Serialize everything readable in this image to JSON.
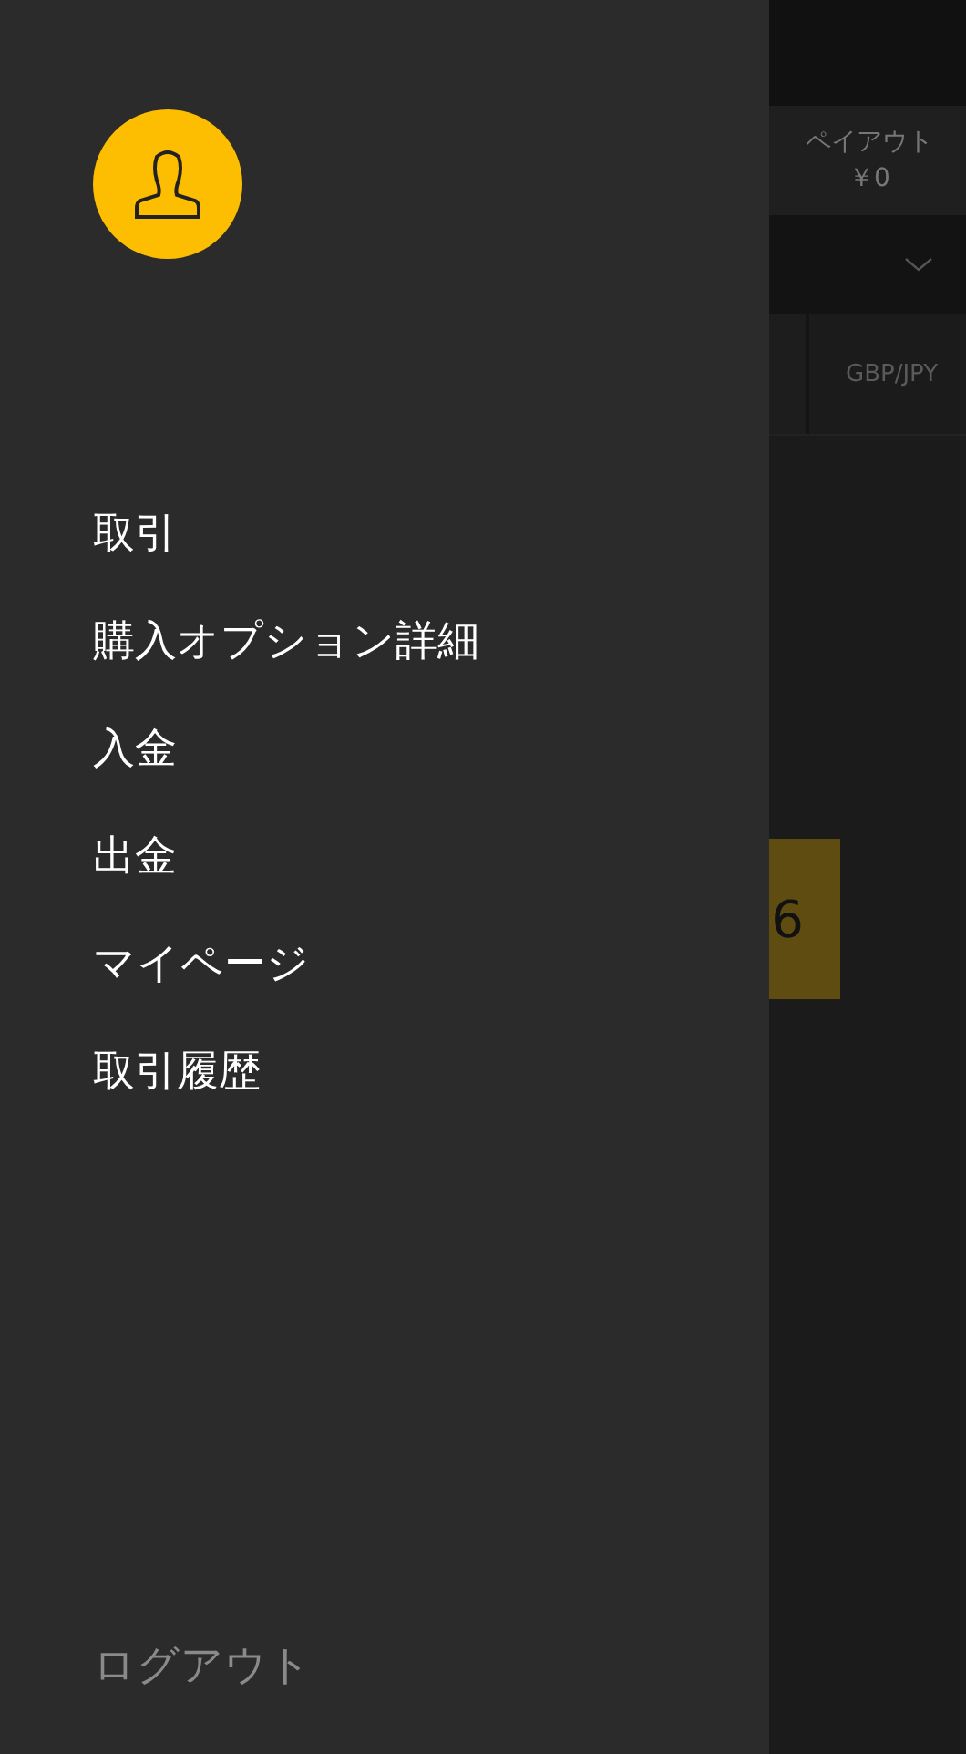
{
  "drawer": {
    "menu": [
      {
        "label": "取引"
      },
      {
        "label": "購入オプション詳細"
      },
      {
        "label": "入金"
      },
      {
        "label": "出金"
      },
      {
        "label": "マイページ"
      },
      {
        "label": "取引履歴"
      }
    ],
    "logout": "ログアウト"
  },
  "background": {
    "payout_label": "ペイアウト",
    "payout_value": "￥0",
    "pair": "GBP/JPY",
    "button_text": "6"
  }
}
